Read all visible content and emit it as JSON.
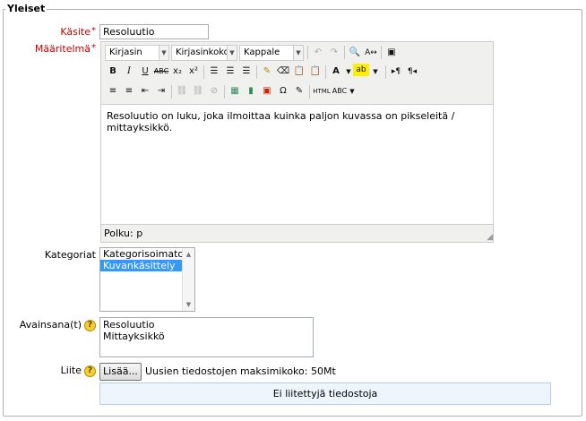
{
  "fieldset": {
    "legend": "Yleiset"
  },
  "concept": {
    "label": "Käsite",
    "required_mark": "*",
    "value": "Resoluutio"
  },
  "definition": {
    "label": "Määritelmä",
    "required_mark": "*",
    "toolbar": {
      "font_family": "Kirjasin",
      "font_size": "Kirjasinkoko",
      "format": "Kappale",
      "html_button": "HTML"
    },
    "content": "Resoluutio on luku, joka ilmoittaa kuinka paljon kuvassa on pikseleitä / mittayksikkö.",
    "status_path": "Polku: p"
  },
  "categories": {
    "label": "Kategoriat",
    "options": [
      {
        "label": "Kategorisoimaton",
        "selected": false
      },
      {
        "label": "Kuvankäsittely",
        "selected": true
      }
    ]
  },
  "keywords": {
    "label": "Avainsana(t)",
    "help": "?",
    "lines": [
      "Resoluutio",
      "Mittayksikkö"
    ]
  },
  "attachment": {
    "label": "Liite",
    "help": "?",
    "add_button": "Lisää...",
    "max_size_text": "Uusien tiedostojen maksimikoko: 50Mt",
    "empty_text": "Ei liitettyjä tiedostoja"
  },
  "colors": {
    "required": "#cc0000",
    "selected": "#3399ff",
    "filebox_bg": "#eef5fd"
  }
}
